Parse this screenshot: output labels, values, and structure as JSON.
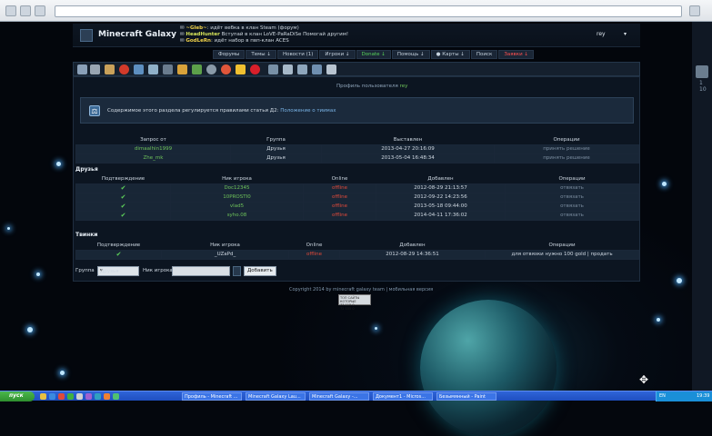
{
  "header": {
    "site_name": "Minecraft Galaxy",
    "username": "rey",
    "news": [
      {
        "nick": "~Gleb~",
        "text": ": идёт вебка в клан Steam (форум)"
      },
      {
        "nick": "HeadHunter",
        "text": "Вступай в клан LoVE-PaRaDiSe Помогай другим!"
      },
      {
        "nick": "GodLeRn",
        "text": ": идёт набор в пвп-клан ACES"
      }
    ]
  },
  "nav": [
    {
      "label": "Форумы",
      "style": "normal"
    },
    {
      "label": "Темы ↓",
      "style": "normal"
    },
    {
      "label": "Новости (1)",
      "style": "normal"
    },
    {
      "label": "Игроки ↓",
      "style": "normal"
    },
    {
      "label": "Donate ↓",
      "style": "green"
    },
    {
      "label": "Помощь ↓",
      "style": "normal"
    },
    {
      "label": "● Карты ↓",
      "style": "normal"
    },
    {
      "label": "Поиск",
      "style": "normal"
    },
    {
      "label": "Заявки ↓",
      "style": "red"
    }
  ],
  "breadcrumb": {
    "prefix": "Профиль пользователя",
    "user": "rey"
  },
  "notice": {
    "text": "Содержимое этого раздела регулируется правилами статьи Д2: ",
    "link": "Положение о тиимах"
  },
  "requests": {
    "headers": [
      "Запрос от",
      "Группа",
      "Выставлен",
      "Операции"
    ],
    "rows": [
      {
        "from": "dimaalhin1999",
        "group": "Друзья",
        "date": "2013-04-27 20:16:09",
        "op": "принять решение"
      },
      {
        "from": "Zhe_mk",
        "group": "Друзья",
        "date": "2013-05-04 16:48:34",
        "op": "принять решение"
      }
    ]
  },
  "friends": {
    "title": "Друзья",
    "headers": [
      "Подтверждение",
      "Ник игрока",
      "Online",
      "Добавлен",
      "Операции"
    ],
    "rows": [
      {
        "confirm": "✔",
        "nick": "Doc12345",
        "status": "offline",
        "date": "2012-08-29 21:13:57",
        "op": "отвязать"
      },
      {
        "confirm": "✔",
        "nick": "10PROSTI0",
        "status": "offline",
        "date": "2012-09-22 14:23:56",
        "op": "отвязать"
      },
      {
        "confirm": "✔",
        "nick": "vlad5",
        "status": "offline",
        "date": "2013-05-18 09:44:00",
        "op": "отвязать"
      },
      {
        "confirm": "✔",
        "nick": "syho.08",
        "status": "offline",
        "date": "2014-04-11 17:36:02",
        "op": "отвязать"
      }
    ]
  },
  "twinks": {
    "title": "Твинки",
    "headers": [
      "Подтверждение",
      "Ник игрока",
      "Online",
      "Добавлен",
      "Операции"
    ],
    "rows": [
      {
        "confirm": "✔",
        "nick": "_UZaPd_",
        "status": "offline",
        "date": "2012-08-29 14:36:51",
        "op": "для отвязки нужно 100 gold | продать"
      }
    ]
  },
  "add_form": {
    "group_label": "Группа",
    "group_value": "Друзья",
    "nick_label": "Ник игрока",
    "button": "Добавить"
  },
  "footer": {
    "copyright": "Copyright 2014 by minecraft galaxy team | мобильная версия",
    "counter": [
      "ТОП САЙТЫ КОТОРЫЕ",
      "77 115   0     ",
      "72 155   0     "
    ]
  },
  "taskbar": {
    "start": "пуск",
    "tasks": [
      "Профиль - Minecraft ...",
      "Minecraft Galaxy Lau...",
      "Minecraft Galaxy -...",
      "Документ1 - Micros...",
      "Безымянный - Paint"
    ],
    "lang": "EN",
    "time": "19:39"
  },
  "sidebar_numbers": [
    "1",
    "10"
  ]
}
